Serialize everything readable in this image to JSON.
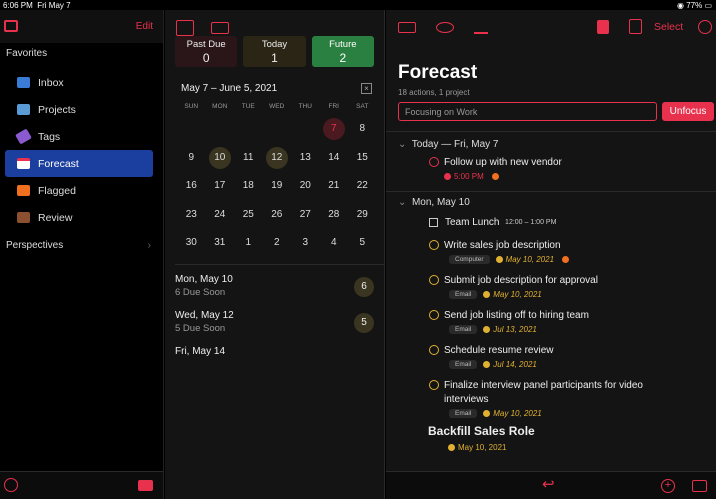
{
  "status": {
    "time": "6:06 PM",
    "date": "Fri May 7",
    "battery": "77%"
  },
  "sidebar": {
    "edit_label": "Edit",
    "favorites_label": "Favorites",
    "items": [
      {
        "label": "Inbox",
        "color": "#3a7bd5"
      },
      {
        "label": "Projects",
        "color": "#5a9bd5"
      },
      {
        "label": "Tags",
        "color": "#8a5bd0"
      },
      {
        "label": "Forecast",
        "color": "#e8324d"
      },
      {
        "label": "Flagged",
        "color": "#f07020"
      },
      {
        "label": "Review",
        "color": "#8a5030"
      }
    ],
    "perspectives_label": "Perspectives"
  },
  "forecast_bar": {
    "past_due": {
      "label": "Past Due",
      "count": "0"
    },
    "today": {
      "label": "Today",
      "count": "1"
    },
    "future": {
      "label": "Future",
      "count": "2"
    }
  },
  "calendar": {
    "range": "May 7 – June 5, 2021",
    "days": [
      "SUN",
      "MON",
      "TUE",
      "WED",
      "THU",
      "FRI",
      "SAT"
    ],
    "weeks": [
      [
        "",
        "",
        "",
        "",
        "",
        "7",
        "8"
      ],
      [
        "9",
        "10",
        "11",
        "12",
        "13",
        "14",
        "15"
      ],
      [
        "16",
        "17",
        "18",
        "19",
        "20",
        "21",
        "22"
      ],
      [
        "23",
        "24",
        "25",
        "26",
        "27",
        "28",
        "29"
      ],
      [
        "30",
        "31",
        "1",
        "2",
        "3",
        "4",
        "5"
      ]
    ]
  },
  "due_list": [
    {
      "day": "Mon, May 10",
      "sub": "6 Due Soon",
      "count": "6"
    },
    {
      "day": "Wed, May 12",
      "sub": "5 Due Soon",
      "count": "5"
    },
    {
      "day": "Fri, May 14",
      "sub": "",
      "count": ""
    }
  ],
  "main": {
    "toolbar_select": "Select",
    "title": "Forecast",
    "subtitle": "18 actions, 1 project",
    "focus_placeholder": "Focusing on Work",
    "unfocus_label": "Unfocus",
    "today_section": "Today — Fri, May 7",
    "today_task": {
      "title": "Follow up with new vendor",
      "time": "5:00 PM"
    },
    "mon_section": "Mon, May 10",
    "event": {
      "title": "Team Lunch",
      "time": "12:00 – 1:00 PM"
    },
    "tasks": [
      {
        "title": "Write sales job description",
        "tag": "Computer",
        "date": "May 10, 2021"
      },
      {
        "title": "Submit job description for approval",
        "tag": "Email",
        "date": "May 10, 2021"
      },
      {
        "title": "Send job listing off to hiring team",
        "tag": "Email",
        "date": "Jul 13, 2021"
      },
      {
        "title": "Schedule resume review",
        "tag": "Email",
        "date": "Jul 14, 2021"
      },
      {
        "title": "Finalize interview panel participants for video",
        "title2": "interviews",
        "tag": "Email",
        "date": "May 10, 2021"
      }
    ],
    "project": {
      "title": "Backfill Sales Role",
      "date": "May 10, 2021"
    }
  }
}
